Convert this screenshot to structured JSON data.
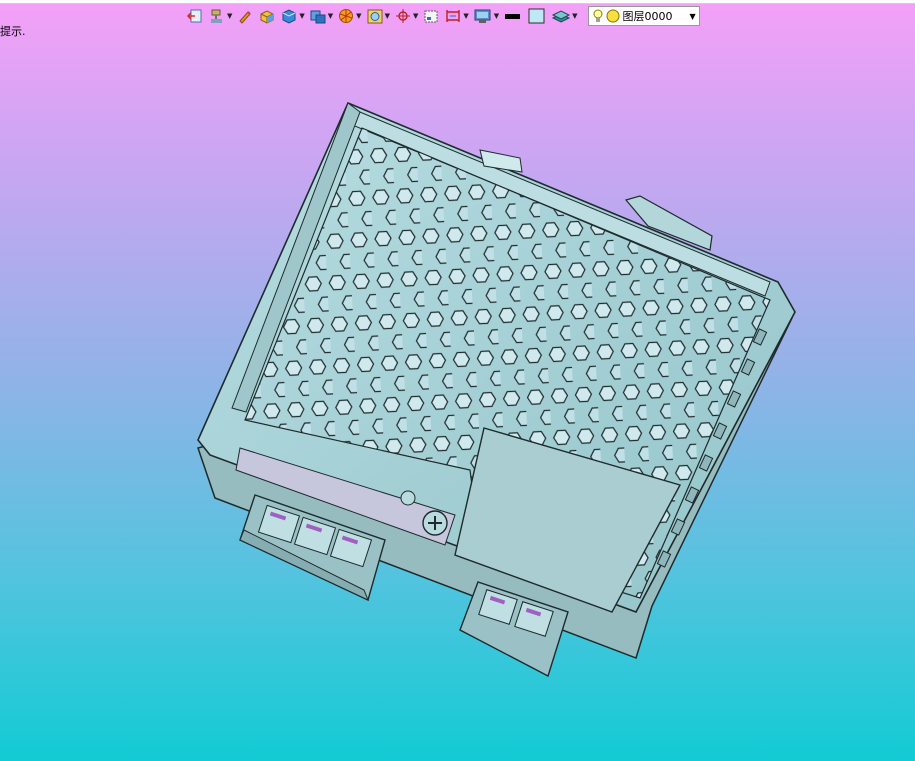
{
  "hint": {
    "label": "提示."
  },
  "toolbar": {
    "icons": [
      "exit-icon",
      "paint-icon",
      "pencil-icon",
      "box-icon",
      "solid-box-icon",
      "view-cube-icon",
      "render-icon",
      "frame-icon",
      "snap-icon",
      "rect-select-icon",
      "dimension-icon",
      "monitor-icon",
      "line-color-icon",
      "fill-color-icon",
      "layers-icon"
    ],
    "layer_name": "图层0000"
  },
  "colors": {
    "bg_top": "#f4a0f8",
    "bg_bottom": "#12cbd4",
    "model_fill": "#a8cfd2",
    "model_edge": "#1e2a2c"
  }
}
